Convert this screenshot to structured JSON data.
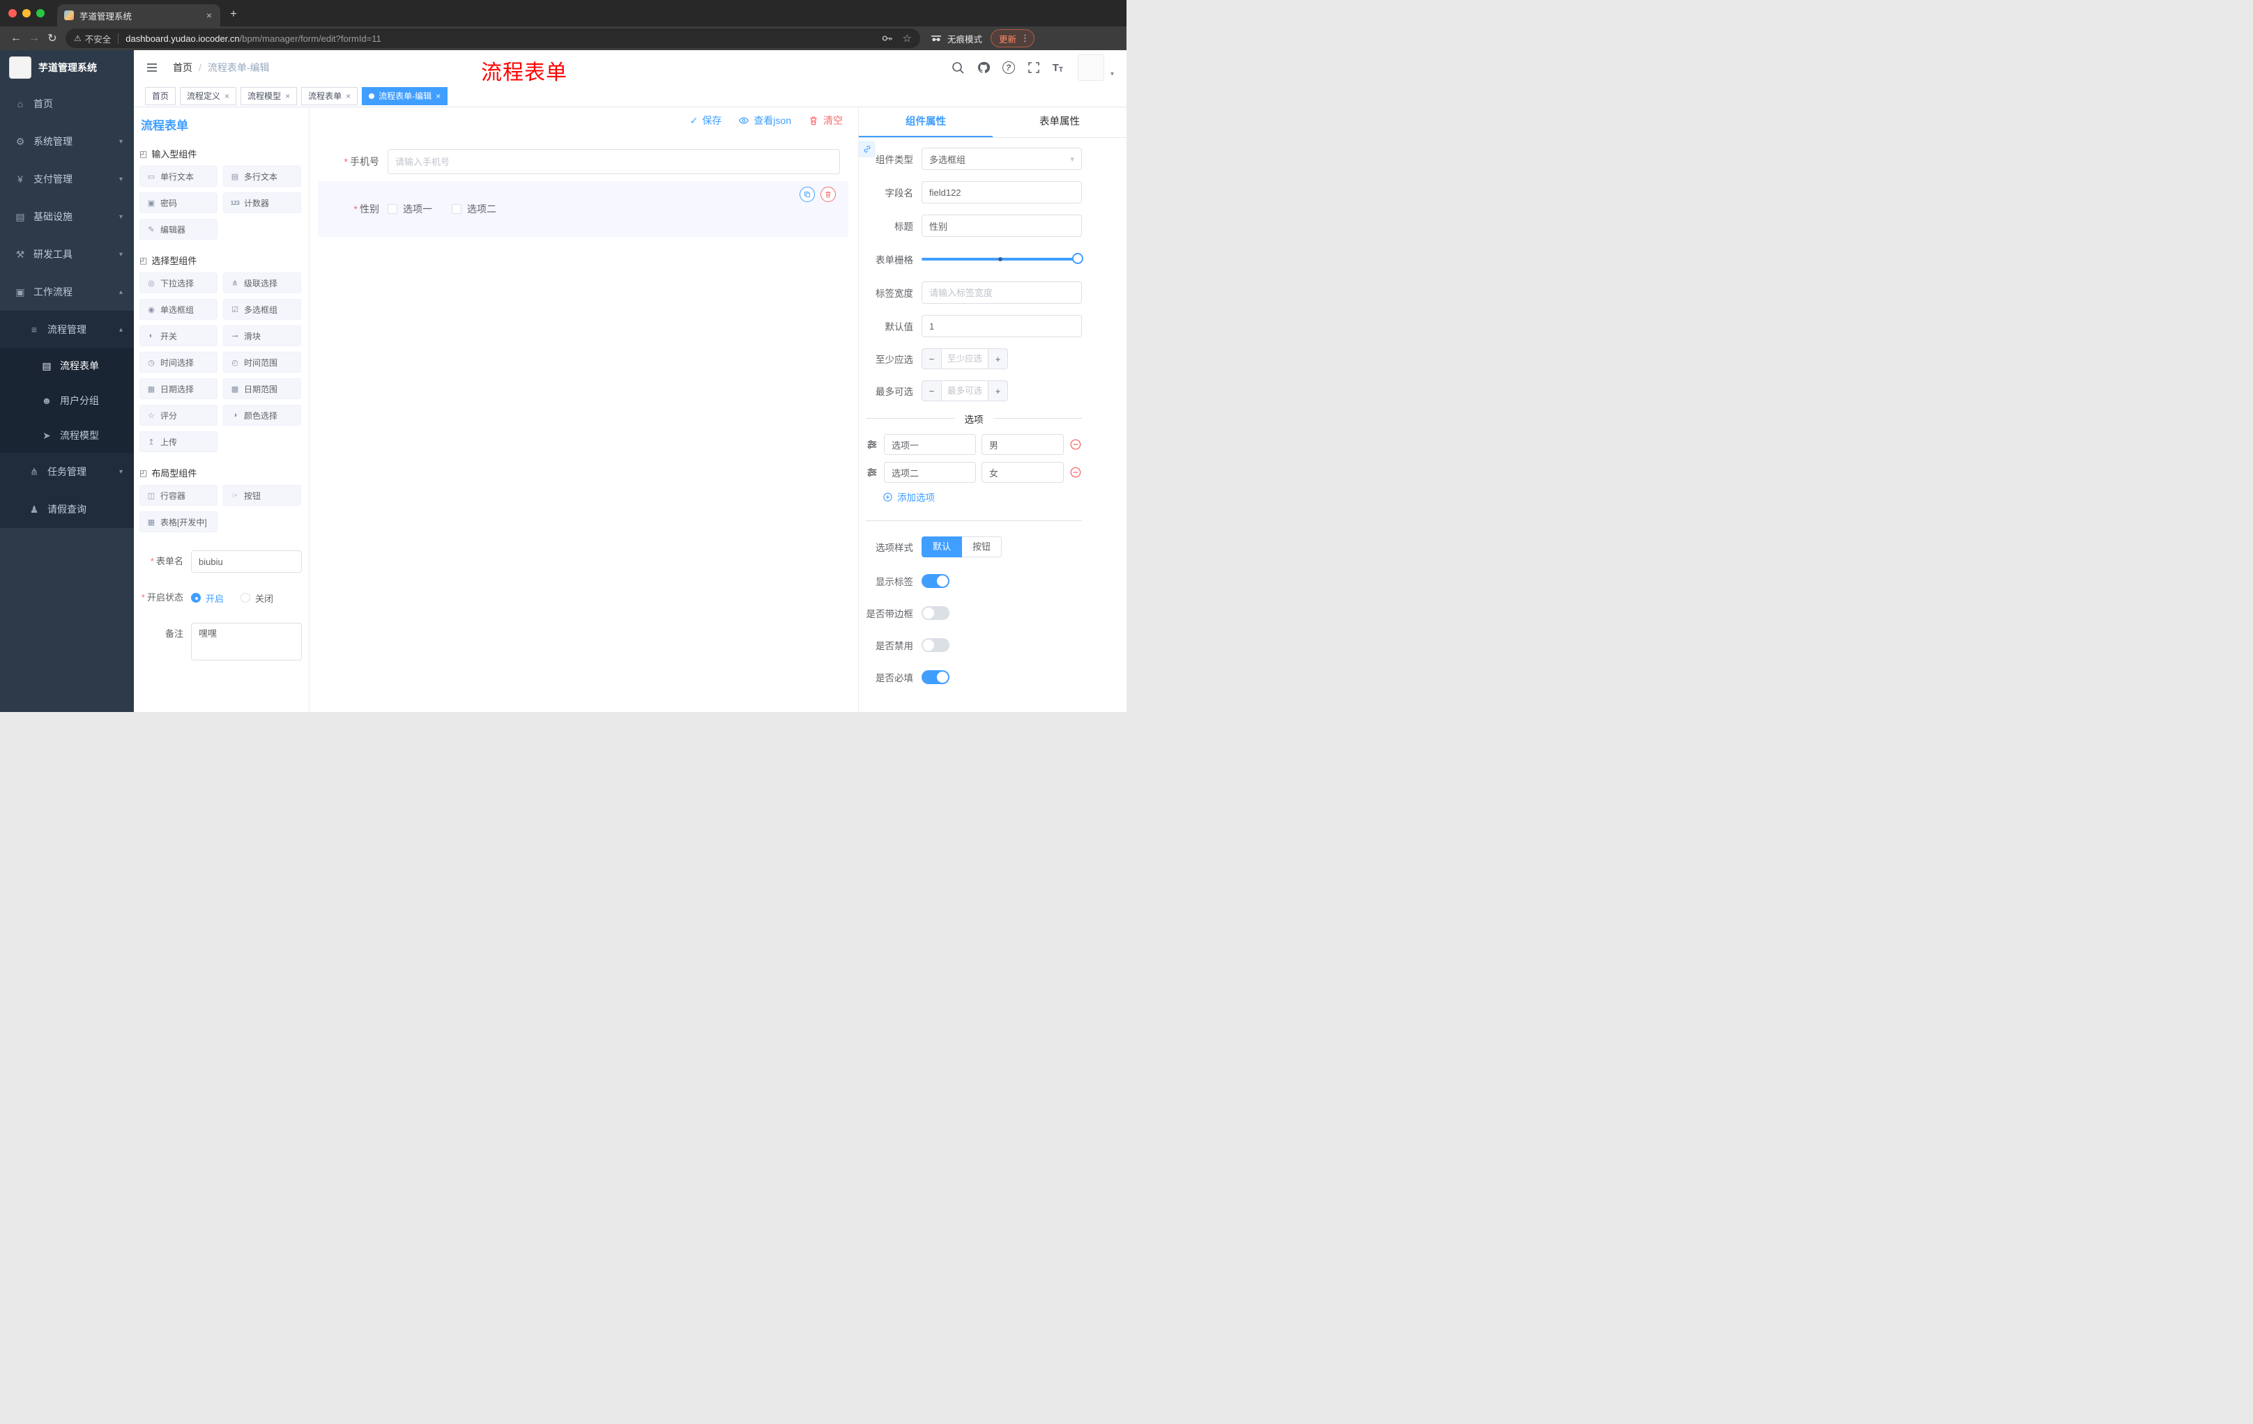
{
  "colors": {
    "accent": "#409eff",
    "danger": "#f56c6c",
    "annotation_red": "#ff0000",
    "sidebar_bg": "#2d3a4a"
  },
  "misc": {
    "required_mark": "*"
  },
  "icons": {
    "close": "×",
    "new_tab": "+",
    "back": "←",
    "forward": "→",
    "reload": "↻",
    "warning": "⚠",
    "star": "☆",
    "kebab": "⋮",
    "chevron_down": "▾",
    "chevron_up": "▴",
    "check": "✓",
    "help": "?",
    "caret": "▾",
    "home": "⌂",
    "gear": "⚙",
    "yen": "¥",
    "infra": "▤",
    "tools": "⚒",
    "workflow": "▣",
    "list": "≡",
    "doc": "▤",
    "users": "☻",
    "send": "➤",
    "fork": "⋔",
    "person": "♟",
    "group_box": "◰",
    "minus": "−",
    "plus": "+"
  },
  "browser": {
    "tab_title": "芋道管理系统",
    "security_label": "不安全",
    "url_host": "dashboard.yudao.iocoder.cn",
    "url_path": "/bpm/manager/form/edit?formId=11",
    "incognito_label": "无痕模式",
    "update_label": "更新"
  },
  "sidebar": {
    "logo_text": "芋道管理系统",
    "menu": [
      {
        "label": "首页"
      },
      {
        "label": "系统管理"
      },
      {
        "label": "支付管理"
      },
      {
        "label": "基础设施"
      },
      {
        "label": "研发工具"
      },
      {
        "label": "工作流程"
      }
    ],
    "submenu": {
      "process_mgmt": "流程管理",
      "children": [
        {
          "label": "流程表单"
        },
        {
          "label": "用户分组"
        },
        {
          "label": "流程模型"
        }
      ],
      "task_mgmt": "任务管理",
      "leave_query": "请假查询"
    }
  },
  "header": {
    "breadcrumb": [
      "首页",
      "流程表单-编辑"
    ],
    "breadcrumb_sep": "/",
    "annotation": "流程表单"
  },
  "tabbar": [
    {
      "label": "首页"
    },
    {
      "label": "流程定义"
    },
    {
      "label": "流程模型"
    },
    {
      "label": "流程表单"
    },
    {
      "label": "流程表单-编辑"
    }
  ],
  "palette": {
    "title": "流程表单",
    "groups": [
      {
        "title": "输入型组件",
        "items": [
          {
            "label": "单行文本",
            "icon": "▭"
          },
          {
            "label": "多行文本",
            "icon": "▤"
          },
          {
            "label": "密码",
            "icon": "▣"
          },
          {
            "label": "计数器",
            "icon": "123"
          },
          {
            "label": "编辑器",
            "icon": "✎"
          }
        ]
      },
      {
        "title": "选择型组件",
        "items": [
          {
            "label": "下拉选择",
            "icon": "◎"
          },
          {
            "label": "级联选择",
            "icon": "⋔"
          },
          {
            "label": "单选框组",
            "icon": "◉"
          },
          {
            "label": "多选框组",
            "icon": "☑"
          },
          {
            "label": "开关",
            "icon": "◐"
          },
          {
            "label": "滑块",
            "icon": "⊸"
          },
          {
            "label": "时间选择",
            "icon": "◷"
          },
          {
            "label": "时间范围",
            "icon": "◴"
          },
          {
            "label": "日期选择",
            "icon": "▦"
          },
          {
            "label": "日期范围",
            "icon": "▩"
          },
          {
            "label": "评分",
            "icon": "☆"
          },
          {
            "label": "颜色选择",
            "icon": "◑"
          },
          {
            "label": "上传",
            "icon": "↥"
          }
        ]
      },
      {
        "title": "布局型组件",
        "items": [
          {
            "label": "行容器",
            "icon": "◫"
          },
          {
            "label": "按钮",
            "icon": "☞"
          },
          {
            "label": "表格[开发中]",
            "icon": "▦"
          }
        ]
      }
    ]
  },
  "form_meta": {
    "name_label": "表单名",
    "name_value": "biubiu",
    "status_label": "开启状态",
    "status_on": "开启",
    "status_off": "关闭",
    "remark_label": "备注",
    "remark_value": "嘿嘿"
  },
  "canvas": {
    "save_label": "保存",
    "view_json_label": "查看json",
    "clear_label": "清空",
    "phone_label": "手机号",
    "phone_placeholder": "请输入手机号",
    "gender_label": "性别",
    "gender_option1": "选项一",
    "gender_option2": "选项二"
  },
  "props": {
    "tab_component": "组件属性",
    "tab_form": "表单属性",
    "component_type_label": "组件类型",
    "component_type_value": "多选框组",
    "field_name_label": "字段名",
    "field_name_value": "field122",
    "title_label": "标题",
    "title_value": "性别",
    "grid_label": "表单栅格",
    "tag_width_label": "标签宽度",
    "tag_width_placeholder": "请输入标签宽度",
    "default_label": "默认值",
    "default_value": "1",
    "min_label": "至少应选",
    "min_placeholder": "至少应选",
    "max_label": "最多可选",
    "max_placeholder": "最多可选",
    "options_title": "选项",
    "options": [
      {
        "label": "选项一",
        "value": "男"
      },
      {
        "label": "选项二",
        "value": "女"
      }
    ],
    "add_option_label": "添加选项",
    "option_style_label": "选项样式",
    "style_default": "默认",
    "style_button": "按钮",
    "toggles": [
      {
        "label": "显示标签",
        "on": true
      },
      {
        "label": "是否带边框",
        "on": false
      },
      {
        "label": "是否禁用",
        "on": false
      },
      {
        "label": "是否必填",
        "on": true
      }
    ]
  }
}
